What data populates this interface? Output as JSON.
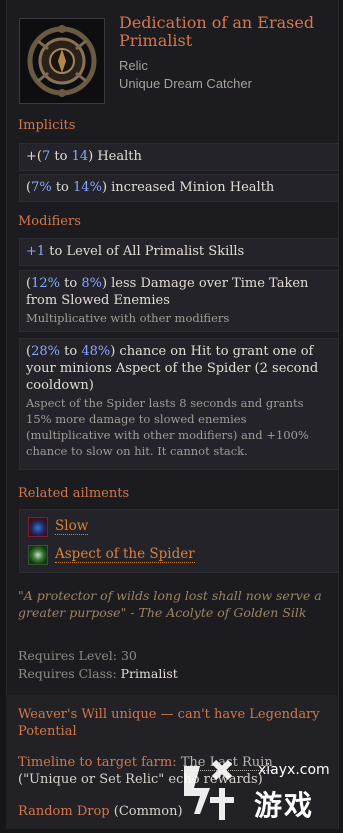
{
  "item": {
    "title": "Dedication of an Erased Primalist",
    "type": "Relic",
    "subtype": "Unique Dream Catcher",
    "icon": "dream-catcher-icon"
  },
  "implicits": {
    "heading": "Implicits",
    "lines": [
      {
        "pre": "+(",
        "a": "7",
        "mid": " to ",
        "b": "14",
        "post": ") Health"
      },
      {
        "pre": "(",
        "a": "7%",
        "mid": " to ",
        "b": "14%",
        "post": ") increased Minion Health"
      }
    ]
  },
  "modifiers": {
    "heading": "Modifiers",
    "lines": [
      {
        "num": "+1",
        "text": " to Level of All Primalist Skills"
      },
      {
        "pre": "(",
        "a": "12%",
        "mid": " to ",
        "b": "8%",
        "post": ") less Damage over Time Taken from Slowed Enemies",
        "note": "Multiplicative with other modifiers"
      },
      {
        "pre": "(",
        "a": "28%",
        "mid": " to ",
        "b": "48%",
        "post": ") chance on Hit to grant one of your minions Aspect of the Spider (2 second cooldown)",
        "note": "Aspect of the Spider lasts 8 seconds and grants 15% more damage to slowed enemies (multiplicative with other modifiers) and +100% chance to slow on hit. It cannot stack."
      }
    ]
  },
  "ailments": {
    "heading": "Related ailments",
    "items": [
      {
        "label": "Slow",
        "icon": "slow-icon"
      },
      {
        "label": "Aspect of the Spider",
        "icon": "spider-icon"
      }
    ]
  },
  "lore": "\"A protector of wilds long lost shall now serve a greater purpose\" - The Acolyte of Golden Silk",
  "requirements": {
    "level_label": "Requires Level: ",
    "level": "30",
    "class_label": "Requires Class: ",
    "class": "Primalist"
  },
  "notes": {
    "weaver": "Weaver's Will unique — can't have Legendary Potential",
    "timeline_label": "Timeline to target farm: ",
    "timeline_link": "The Last Ruin",
    "timeline_tail": " (\"Unique or Set Relic\" echo rewards)",
    "drop_label": "Random Drop",
    "drop_rarity": " (Common)"
  },
  "watermark": {
    "site": "xiayx.com",
    "logo_text": "游戏"
  },
  "colors": {
    "accent": "#d5774a",
    "number": "#8aa8ff",
    "background": "#1b1b20"
  }
}
